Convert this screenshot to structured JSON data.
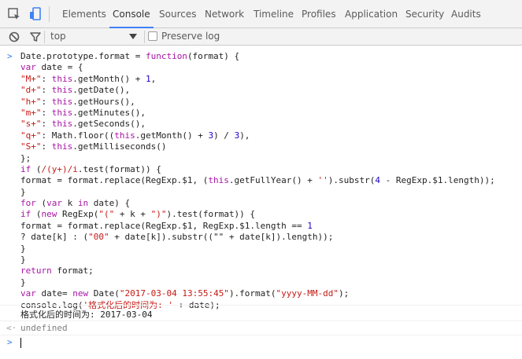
{
  "tabs": [
    "Elements",
    "Console",
    "Sources",
    "Network",
    "Timeline",
    "Profiles",
    "Application",
    "Security",
    "Audits"
  ],
  "active_tab": "Console",
  "filter": {
    "context": "top",
    "preserve_log_label": "Preserve log",
    "preserve_log_checked": false
  },
  "code_lines": [
    [
      [
        "p",
        "Date.prototype.format = "
      ],
      [
        "k",
        "function"
      ],
      [
        "p",
        "(format) {"
      ]
    ],
    [
      [
        "k",
        "var"
      ],
      [
        "p",
        " date = {"
      ]
    ],
    [
      [
        "s",
        "\"M+\""
      ],
      [
        "p",
        ": "
      ],
      [
        "k",
        "this"
      ],
      [
        "p",
        ".getMonth() + "
      ],
      [
        "n",
        "1"
      ],
      [
        "p",
        ","
      ]
    ],
    [
      [
        "s",
        "\"d+\""
      ],
      [
        "p",
        ": "
      ],
      [
        "k",
        "this"
      ],
      [
        "p",
        ".getDate(),"
      ]
    ],
    [
      [
        "s",
        "\"h+\""
      ],
      [
        "p",
        ": "
      ],
      [
        "k",
        "this"
      ],
      [
        "p",
        ".getHours(),"
      ]
    ],
    [
      [
        "s",
        "\"m+\""
      ],
      [
        "p",
        ": "
      ],
      [
        "k",
        "this"
      ],
      [
        "p",
        ".getMinutes(),"
      ]
    ],
    [
      [
        "s",
        "\"s+\""
      ],
      [
        "p",
        ": "
      ],
      [
        "k",
        "this"
      ],
      [
        "p",
        ".getSeconds(),"
      ]
    ],
    [
      [
        "s",
        "\"q+\""
      ],
      [
        "p",
        ": Math.floor(("
      ],
      [
        "k",
        "this"
      ],
      [
        "p",
        ".getMonth() + "
      ],
      [
        "n",
        "3"
      ],
      [
        "p",
        ") / "
      ],
      [
        "n",
        "3"
      ],
      [
        "p",
        "),"
      ]
    ],
    [
      [
        "s",
        "\"S+\""
      ],
      [
        "p",
        ": "
      ],
      [
        "k",
        "this"
      ],
      [
        "p",
        ".getMilliseconds()"
      ]
    ],
    [
      [
        "p",
        "};"
      ]
    ],
    [
      [
        "k",
        "if"
      ],
      [
        "p",
        " ("
      ],
      [
        "s",
        "/(y+)/i"
      ],
      [
        "p",
        ".test(format)) {"
      ]
    ],
    [
      [
        "p",
        "format = format.replace(RegExp.$1, ("
      ],
      [
        "k",
        "this"
      ],
      [
        "p",
        ".getFullYear() + "
      ],
      [
        "s",
        "''"
      ],
      [
        "p",
        ").substr("
      ],
      [
        "n",
        "4"
      ],
      [
        "p",
        " - RegExp.$1.length));"
      ]
    ],
    [
      [
        "p",
        "}"
      ]
    ],
    [
      [
        "k",
        "for"
      ],
      [
        "p",
        " ("
      ],
      [
        "k",
        "var"
      ],
      [
        "p",
        " k "
      ],
      [
        "k",
        "in"
      ],
      [
        "p",
        " date) {"
      ]
    ],
    [
      [
        "k",
        "if"
      ],
      [
        "p",
        " ("
      ],
      [
        "k",
        "new"
      ],
      [
        "p",
        " RegExp("
      ],
      [
        "s",
        "\"(\""
      ],
      [
        "p",
        " + k + "
      ],
      [
        "s",
        "\")\""
      ],
      [
        "p",
        ").test(format)) {"
      ]
    ],
    [
      [
        "p",
        "format = format.replace(RegExp.$1, RegExp.$1.length == "
      ],
      [
        "n",
        "1"
      ]
    ],
    [
      [
        "p",
        "? date[k] : ("
      ],
      [
        "s",
        "\"00\""
      ],
      [
        "p",
        " + date[k]).substr((\"\" + date[k]).length));"
      ]
    ],
    [
      [
        "p",
        "}"
      ]
    ],
    [
      [
        "p",
        "}"
      ]
    ],
    [
      [
        "k",
        "return"
      ],
      [
        "p",
        " format;"
      ]
    ],
    [
      [
        "p",
        "}"
      ]
    ],
    [
      [
        "k",
        "var"
      ],
      [
        "p",
        " date= "
      ],
      [
        "k",
        "new"
      ],
      [
        "p",
        " Date("
      ],
      [
        "s",
        "\"2017-03-04 13:55:45\""
      ],
      [
        "p",
        ").format("
      ],
      [
        "s",
        "\"yyyy-MM-dd\""
      ],
      [
        "p",
        ");"
      ]
    ],
    [
      [
        "p",
        "console.log("
      ],
      [
        "s",
        "'格式化后的时间为: '"
      ],
      [
        "p",
        " + date);"
      ]
    ]
  ],
  "log_output": "格式化后的时间为: 2017-03-04",
  "return_value": "undefined",
  "colors": {
    "keyword": "#a815a6",
    "string": "#c41a16",
    "number": "#1c00cf",
    "active_tab_underline": "#3e82f7",
    "prompt": "#367cf1"
  }
}
